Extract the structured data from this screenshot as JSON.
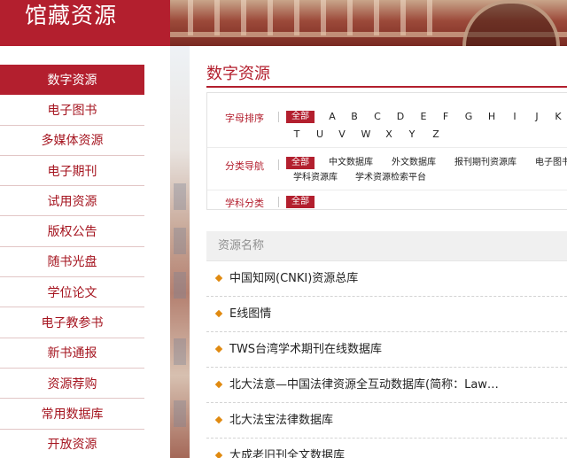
{
  "header": {
    "title": "馆藏资源"
  },
  "sidebar": {
    "items": [
      {
        "label": "数字资源",
        "active": true
      },
      {
        "label": "电子图书"
      },
      {
        "label": "多媒体资源"
      },
      {
        "label": "电子期刊"
      },
      {
        "label": "试用资源"
      },
      {
        "label": "版权公告"
      },
      {
        "label": "随书光盘"
      },
      {
        "label": "学位论文"
      },
      {
        "label": "电子教参书"
      },
      {
        "label": "新书通报"
      },
      {
        "label": "资源荐购"
      },
      {
        "label": "常用数据库"
      },
      {
        "label": "开放资源"
      }
    ]
  },
  "main": {
    "title": "数字资源",
    "filters": {
      "alphabet": {
        "label": "字母排序",
        "all": "全部",
        "letters": [
          "A",
          "B",
          "C",
          "D",
          "E",
          "F",
          "G",
          "H",
          "I",
          "J",
          "K",
          "T",
          "U",
          "V",
          "W",
          "X",
          "Y",
          "Z"
        ]
      },
      "category_nav": {
        "label": "分类导航",
        "all": "全部",
        "options": [
          "中文数据库",
          "外文数据库",
          "报刊期刊资源库",
          "电子图书",
          "学科资源库",
          "学术资源检索平台"
        ]
      },
      "subject": {
        "label": "学科分类",
        "all": "全部"
      }
    },
    "list": {
      "header": "资源名称",
      "items": [
        "中国知网(CNKI)资源总库",
        "E线图情",
        "TWS台湾学术期刊在线数据库",
        "北大法意—中国法律资源全互动数据库(简称：Law…",
        "北大法宝法律数据库",
        "大成老旧刊全文数据库"
      ]
    }
  },
  "colors": {
    "brand": "#b31f2e",
    "bullet": "#e08a10"
  }
}
